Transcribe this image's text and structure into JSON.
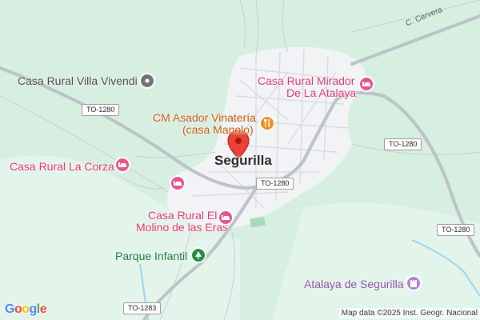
{
  "places": {
    "villa_vivendi": "Casa Rural Villa Vivendi",
    "mirador": "Casa Rural Mirador",
    "mirador_2": "De La Atalaya",
    "asador": "CM Asador Vinatería",
    "asador_2": "(casa Manolo)",
    "la_corza": "Casa Rural La Corza",
    "molino": "Casa Rural El",
    "molino_2": "Molino de las Eras",
    "parque": "Parque Infantil",
    "atalaya": "Atalaya de Segurilla"
  },
  "town": "Segurilla",
  "roads": {
    "to1280_a": "TO-1280",
    "to1280_b": "TO-1280",
    "to1280_c": "TO-1280",
    "to1280_d": "TO-1280",
    "to1283": "TO-1283",
    "cervera": "C. Cervera"
  },
  "branding": {
    "G": "G",
    "o1": "o",
    "o2": "o",
    "g": "g",
    "l": "l",
    "e": "e"
  },
  "attribution": "Map data ©2025 Inst. Geogr. Nacional",
  "colors": {
    "land": "#d6efe0",
    "urban": "#f1f3f4",
    "road": "#c3c8cd",
    "pink_poi": "#e7528a",
    "food_poi": "#f08c1e",
    "park_poi": "#1e8e3e",
    "sight_poi": "#b17fd4",
    "pin": "#ea4335"
  },
  "icons": {
    "hotel": "bed-icon",
    "food": "fork-knife-icon",
    "park": "tree-icon",
    "sight": "castle-icon",
    "place": "place-dot-icon",
    "pin": "map-pin-icon"
  }
}
